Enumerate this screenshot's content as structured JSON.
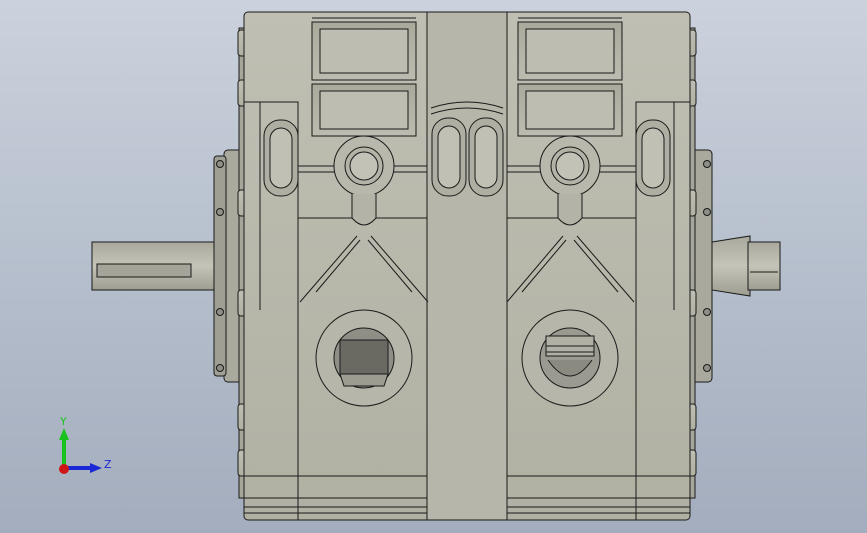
{
  "viewport": {
    "background_top": "#cbd2dd",
    "background_bottom": "#a3adbd",
    "model_fill": "#b9b9ad",
    "model_shade": "#a7a79a",
    "model_edge": "#1a1a1a"
  },
  "triad": {
    "y_label": "Y",
    "z_label": "Z",
    "y_color": "#19c21f",
    "z_color": "#1a28d6",
    "x_color": "#d01717"
  }
}
